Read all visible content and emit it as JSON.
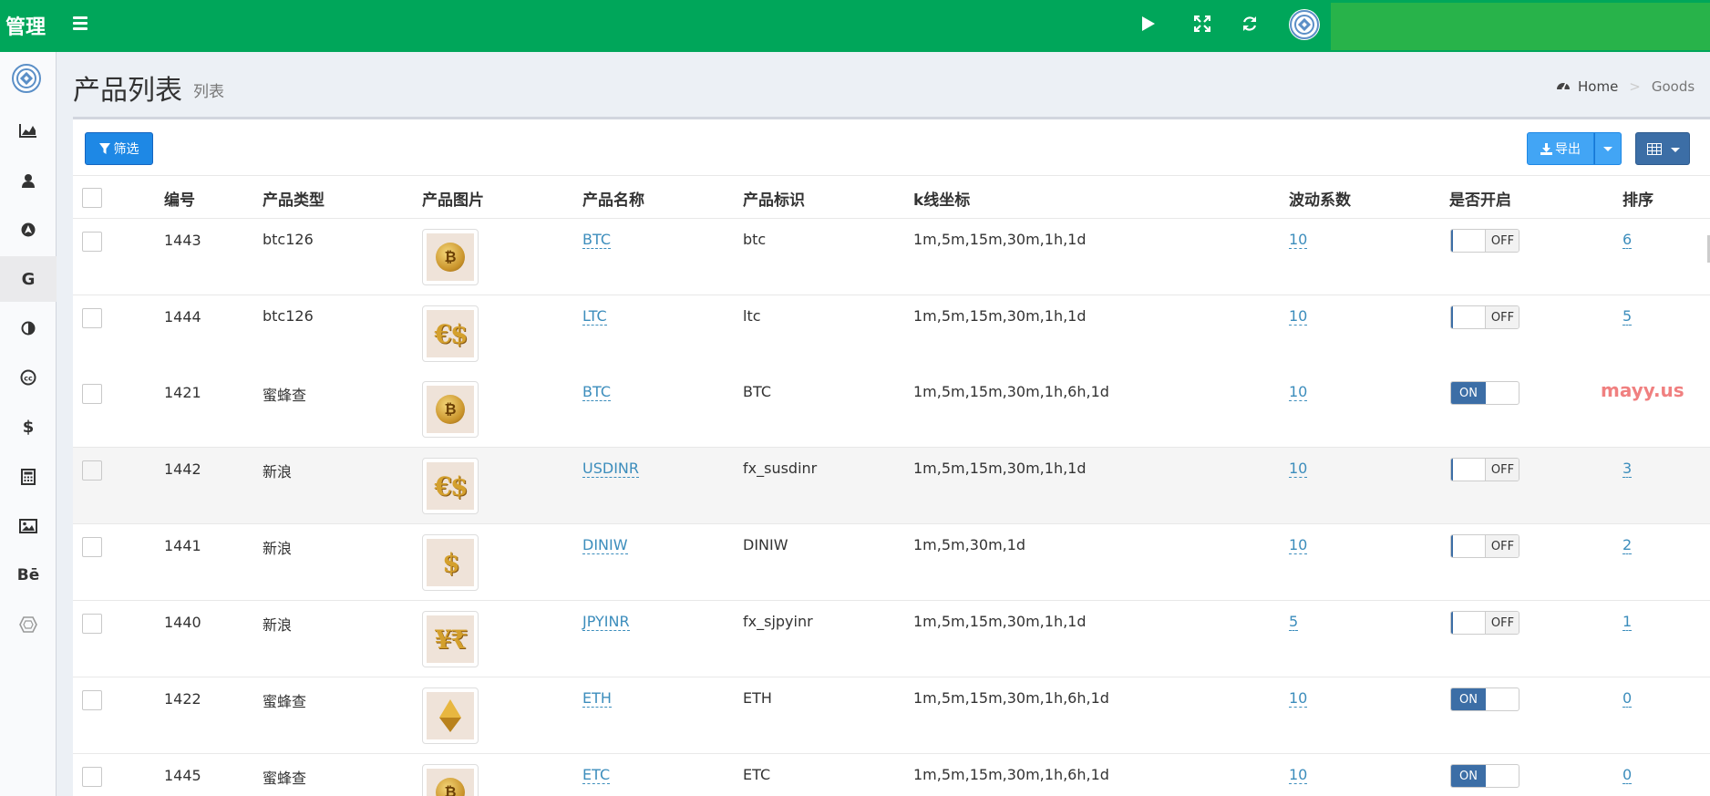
{
  "header": {
    "logo_text": "管理",
    "icons": [
      "menu-icon",
      "play-icon",
      "fullscreen-icon",
      "refresh-icon",
      "avatar"
    ]
  },
  "sidebar": {
    "items": [
      "logo-icon",
      "area-chart-icon",
      "user-icon",
      "navigation-icon",
      "google-icon",
      "contrast-icon",
      "creative-commons-icon",
      "dollar-icon",
      "calculator-icon",
      "image-icon",
      "behance-icon",
      "hexagon-icon"
    ]
  },
  "page": {
    "title": "产品列表",
    "subtitle": "列表",
    "breadcrumb": [
      "Home",
      "Goods"
    ]
  },
  "toolbar": {
    "filter_label": "筛选",
    "export_label": "导出"
  },
  "table": {
    "columns": [
      "编号",
      "产品类型",
      "产品图片",
      "产品名称",
      "产品标识",
      "k线坐标",
      "波动系数",
      "是否开启",
      "排序"
    ],
    "rows": [
      {
        "id": "1443",
        "type": "btc126",
        "image": "bitcoin",
        "name": "BTC",
        "code": "btc",
        "kline": "1m,5m,15m,30m,1h,1d",
        "factor": "10",
        "enabled": "OFF",
        "sort": "6"
      },
      {
        "id": "1444",
        "type": "btc126",
        "image": "euro-dollar",
        "name": "LTC",
        "code": "ltc",
        "kline": "1m,5m,15m,30m,1h,1d",
        "factor": "10",
        "enabled": "OFF",
        "sort": "5"
      },
      {
        "id": "1421",
        "type": "蜜蜂查",
        "image": "bitcoin",
        "name": "BTC",
        "code": "BTC",
        "kline": "1m,5m,15m,30m,1h,6h,1d",
        "factor": "10",
        "enabled": "ON",
        "sort": ""
      },
      {
        "id": "1442",
        "type": "新浪",
        "image": "euro-dollar",
        "name": "USDINR",
        "code": "fx_susdinr",
        "kline": "1m,5m,15m,30m,1h,1d",
        "factor": "10",
        "enabled": "OFF",
        "sort": "3"
      },
      {
        "id": "1441",
        "type": "新浪",
        "image": "dollar",
        "name": "DINIW",
        "code": "DINIW",
        "kline": "1m,5m,30m,1d",
        "factor": "10",
        "enabled": "OFF",
        "sort": "2"
      },
      {
        "id": "1440",
        "type": "新浪",
        "image": "yen-rupee",
        "name": "JPYINR",
        "code": "fx_sjpyinr",
        "kline": "1m,5m,15m,30m,1h,1d",
        "factor": "5",
        "enabled": "OFF",
        "sort": "1"
      },
      {
        "id": "1422",
        "type": "蜜蜂查",
        "image": "ethereum",
        "name": "ETH",
        "code": "ETH",
        "kline": "1m,5m,15m,30m,1h,6h,1d",
        "factor": "10",
        "enabled": "ON",
        "sort": "0"
      },
      {
        "id": "1445",
        "type": "蜜蜂查",
        "image": "bitcoin",
        "name": "ETC",
        "code": "ETC",
        "kline": "1m,5m,15m,30m,1h,6h,1d",
        "factor": "10",
        "enabled": "ON",
        "sort": "0"
      }
    ]
  },
  "glyphs": {
    "bitcoin": "₿",
    "euro-dollar": "€$",
    "dollar": "$",
    "yen-rupee": "¥₹"
  },
  "watermark": "mayy.us",
  "colors": {
    "header_green": "#00a65a",
    "link_blue": "#3c8dbc",
    "toggle_blue": "#3c6ea6"
  }
}
